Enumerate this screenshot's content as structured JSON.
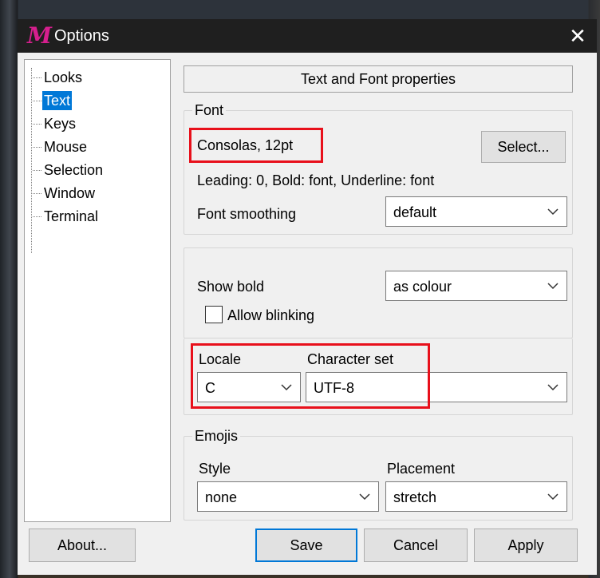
{
  "window": {
    "title": "Options",
    "app_icon_letter": "M",
    "close_symbol": "✕"
  },
  "tree": {
    "items": [
      {
        "label": "Looks",
        "selected": false
      },
      {
        "label": "Text",
        "selected": true
      },
      {
        "label": "Keys",
        "selected": false
      },
      {
        "label": "Mouse",
        "selected": false
      },
      {
        "label": "Selection",
        "selected": false
      },
      {
        "label": "Window",
        "selected": false
      },
      {
        "label": "Terminal",
        "selected": false
      }
    ]
  },
  "panel": {
    "header": "Text and Font properties",
    "font_group": {
      "title": "Font",
      "current_font": "Consolas, 12pt",
      "select_button": "Select...",
      "details": "Leading: 0, Bold: font, Underline: font",
      "smoothing_label": "Font smoothing",
      "smoothing_value": "default"
    },
    "bold_group": {
      "show_bold_label": "Show bold",
      "show_bold_value": "as colour",
      "allow_blinking_label": "Allow blinking",
      "allow_blinking_checked": false
    },
    "locale_group": {
      "locale_label": "Locale",
      "locale_value": "C",
      "charset_label": "Character set",
      "charset_value": "UTF-8"
    },
    "emoji_group": {
      "title": "Emojis",
      "style_label": "Style",
      "style_value": "none",
      "placement_label": "Placement",
      "placement_value": "stretch"
    }
  },
  "footer": {
    "about": "About...",
    "save": "Save",
    "cancel": "Cancel",
    "apply": "Apply"
  },
  "colors": {
    "accent": "#0078d7",
    "highlight_annotation": "#e8101b",
    "app_icon": "#d61f8e"
  }
}
